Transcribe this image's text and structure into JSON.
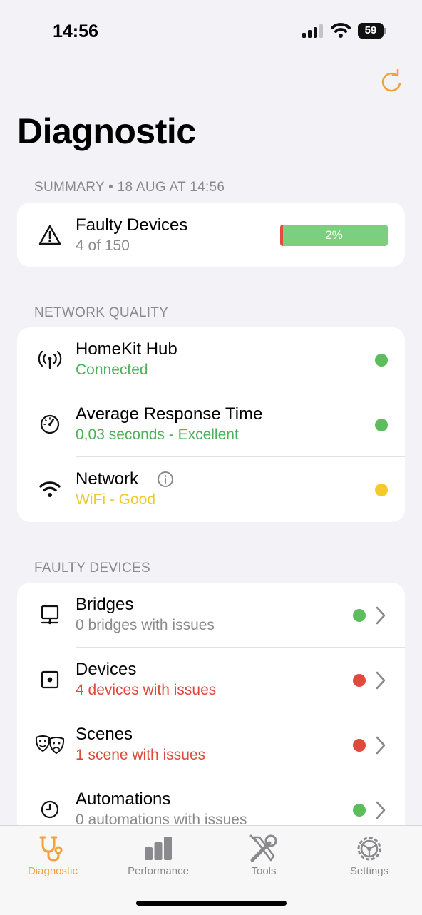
{
  "status_bar": {
    "time": "14:56",
    "battery": "59"
  },
  "page": {
    "title": "Diagnostic"
  },
  "summary": {
    "header": "SUMMARY • 18 AUG AT 14:56",
    "faulty": {
      "title": "Faulty Devices",
      "subtitle": "4 of 150",
      "progress_label": "2%",
      "progress_fraction": 0.027
    }
  },
  "network": {
    "header": "NETWORK QUALITY",
    "rows": [
      {
        "icon": "antenna-icon",
        "title": "HomeKit Hub",
        "subtitle": "Connected",
        "subtitle_color": "#4cb05a",
        "dot_color": "#5cbd5c"
      },
      {
        "icon": "gauge-icon",
        "title": "Average Response Time",
        "subtitle": "0,03 seconds - Excellent",
        "subtitle_color": "#4cb05a",
        "dot_color": "#5cbd5c"
      },
      {
        "icon": "wifi-icon",
        "title": "Network",
        "subtitle": "WiFi - Good",
        "subtitle_color": "#f0c928",
        "dot_color": "#f3c92c"
      }
    ]
  },
  "faulty_devices": {
    "header": "FAULTY DEVICES",
    "rows": [
      {
        "icon": "bridge-icon",
        "title": "Bridges",
        "subtitle": "0 bridges with issues",
        "subtitle_color": "#8a8a8e",
        "dot_color": "#5cbd5c"
      },
      {
        "icon": "device-icon",
        "title": "Devices",
        "subtitle": "4 devices with issues",
        "subtitle_color": "#dd4a3a",
        "dot_color": "#e04a3c"
      },
      {
        "icon": "theater-masks-icon",
        "title": "Scenes",
        "subtitle": "1 scene with issues",
        "subtitle_color": "#dd4a3a",
        "dot_color": "#e04a3c"
      },
      {
        "icon": "clock-icon",
        "title": "Automations",
        "subtitle": "0 automations with issues",
        "subtitle_color": "#8a8a8e",
        "dot_color": "#5cbd5c"
      }
    ]
  },
  "tabs": [
    {
      "label": "Diagnostic",
      "icon": "stethoscope-icon",
      "active": true
    },
    {
      "label": "Performance",
      "icon": "bar-chart-icon",
      "active": false
    },
    {
      "label": "Tools",
      "icon": "tools-icon",
      "active": false
    },
    {
      "label": "Settings",
      "icon": "gear-icon",
      "active": false
    }
  ],
  "colors": {
    "accent": "#f0a33a",
    "green": "#5cbd5c",
    "red": "#e04a3c",
    "yellow": "#f3c92c"
  }
}
